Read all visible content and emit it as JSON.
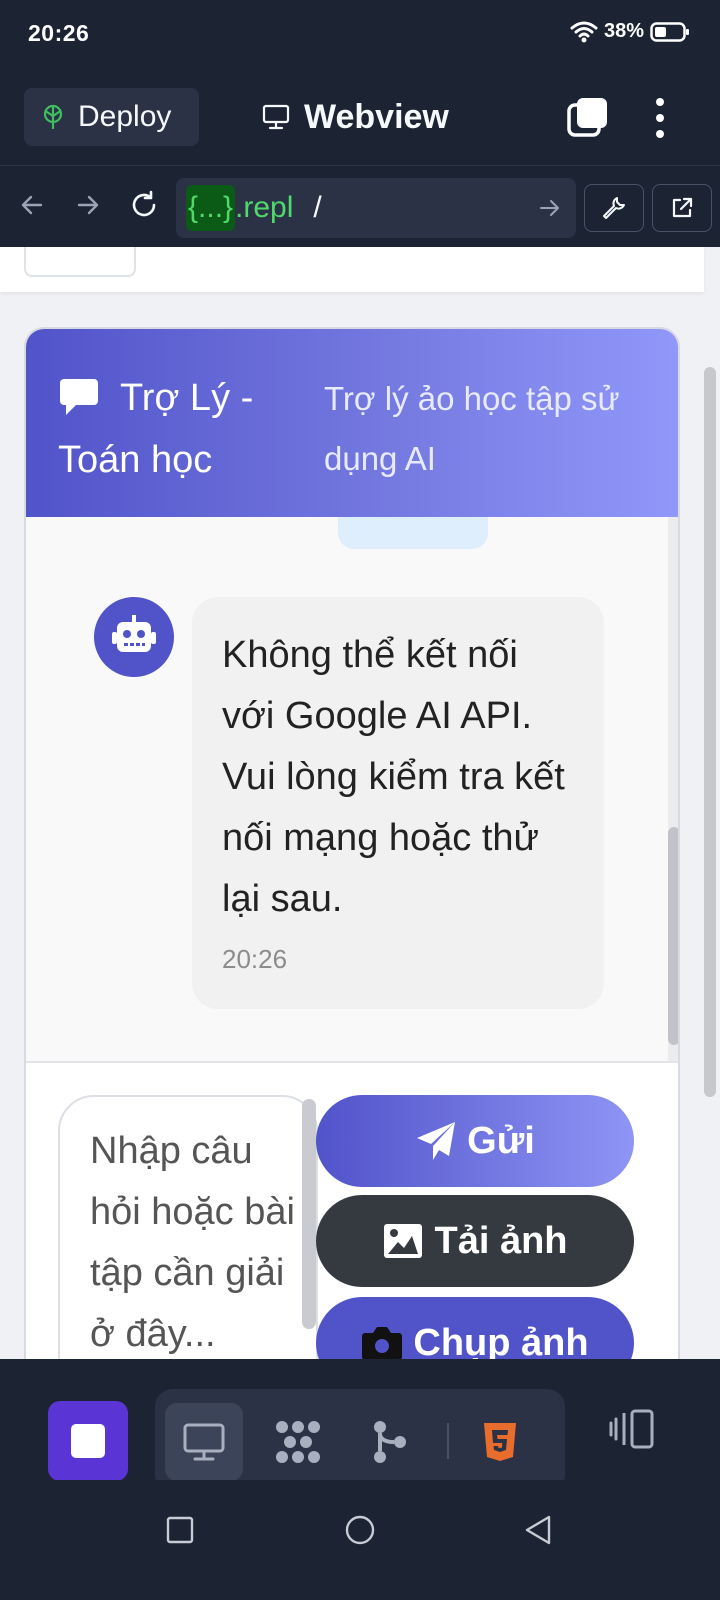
{
  "status_bar": {
    "time": "20:26",
    "battery": "38%"
  },
  "app_bar": {
    "deploy_label": "Deploy",
    "webview_label": "Webview",
    "icons": [
      "deploy-icon",
      "monitor-icon",
      "tabs-icon",
      "kebab-menu-icon"
    ]
  },
  "url_bar": {
    "braces": "{...}",
    "host": ".repl",
    "path": "/",
    "icons": [
      "back-arrow-icon",
      "forward-arrow-icon",
      "reload-icon",
      "go-arrow-icon",
      "wrench-icon",
      "open-external-icon"
    ]
  },
  "chat": {
    "title": "Trợ Lý - Toán học",
    "subtitle": "Trợ lý ảo học tập sử dụng AI",
    "bot_message": "Không thể kết nối với Google AI API. Vui lòng kiểm tra kết nối mạng hoặc thử lại sau.",
    "bot_timestamp": "20:26",
    "input_placeholder": "Nhập câu hỏi hoặc bài tập cần giải ở đây...",
    "send_label": "Gửi",
    "upload_label": "Tải ảnh",
    "camera_label": "Chụp ảnh"
  },
  "colors": {
    "accent": "#5153c9",
    "header_gradient_end": "#9198fa",
    "replit_bg": "#1c2333",
    "stop_button": "#5b34d6",
    "url_green": "#4fd96a"
  },
  "bottom_toolbar": {
    "icons": [
      "stop-icon",
      "webview-monitor-icon",
      "workflow-icon",
      "git-branch-icon",
      "html5-icon",
      "layout-panels-icon"
    ]
  },
  "system_nav": {
    "icons": [
      "recents-icon",
      "home-icon",
      "back-icon"
    ]
  }
}
